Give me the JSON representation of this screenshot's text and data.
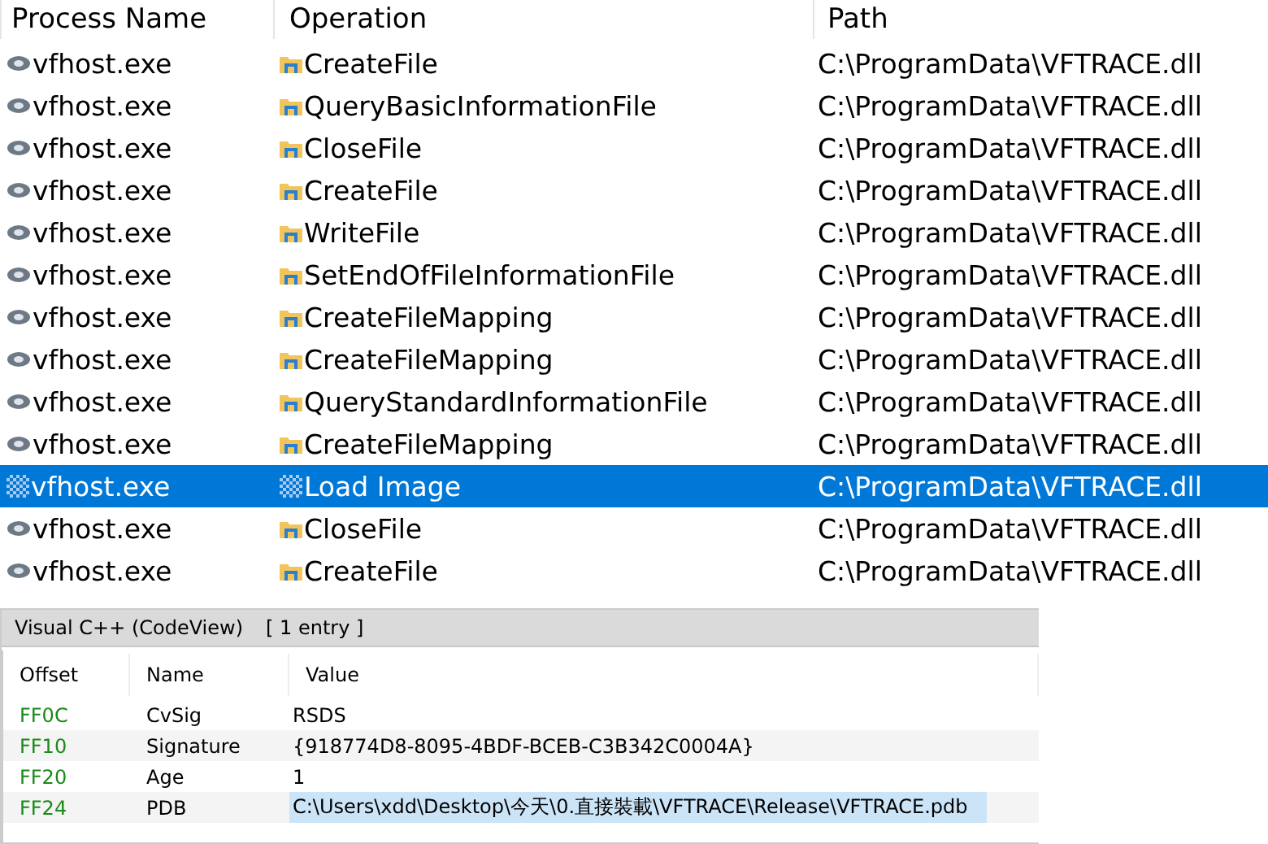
{
  "events": {
    "columns": [
      "Process Name",
      "Operation",
      "Path"
    ],
    "rows": [
      {
        "process": "vfhost.exe",
        "operation": "CreateFile",
        "kind": "file",
        "path": "C:\\ProgramData\\VFTRACE.dll",
        "selected": false
      },
      {
        "process": "vfhost.exe",
        "operation": "QueryBasicInformationFile",
        "kind": "file",
        "path": "C:\\ProgramData\\VFTRACE.dll",
        "selected": false
      },
      {
        "process": "vfhost.exe",
        "operation": "CloseFile",
        "kind": "file",
        "path": "C:\\ProgramData\\VFTRACE.dll",
        "selected": false
      },
      {
        "process": "vfhost.exe",
        "operation": "CreateFile",
        "kind": "file",
        "path": "C:\\ProgramData\\VFTRACE.dll",
        "selected": false
      },
      {
        "process": "vfhost.exe",
        "operation": "WriteFile",
        "kind": "file",
        "path": "C:\\ProgramData\\VFTRACE.dll",
        "selected": false
      },
      {
        "process": "vfhost.exe",
        "operation": "SetEndOfFileInformationFile",
        "kind": "file",
        "path": "C:\\ProgramData\\VFTRACE.dll",
        "selected": false
      },
      {
        "process": "vfhost.exe",
        "operation": "CreateFileMapping",
        "kind": "file",
        "path": "C:\\ProgramData\\VFTRACE.dll",
        "selected": false
      },
      {
        "process": "vfhost.exe",
        "operation": "CreateFileMapping",
        "kind": "file",
        "path": "C:\\ProgramData\\VFTRACE.dll",
        "selected": false
      },
      {
        "process": "vfhost.exe",
        "operation": "QueryStandardInformationFile",
        "kind": "file",
        "path": "C:\\ProgramData\\VFTRACE.dll",
        "selected": false
      },
      {
        "process": "vfhost.exe",
        "operation": "CreateFileMapping",
        "kind": "file",
        "path": "C:\\ProgramData\\VFTRACE.dll",
        "selected": false
      },
      {
        "process": "vfhost.exe",
        "operation": "Load Image",
        "kind": "image",
        "path": "C:\\ProgramData\\VFTRACE.dll",
        "selected": true
      },
      {
        "process": "vfhost.exe",
        "operation": "CloseFile",
        "kind": "file",
        "path": "C:\\ProgramData\\VFTRACE.dll",
        "selected": false
      },
      {
        "process": "vfhost.exe",
        "operation": "CreateFile",
        "kind": "file",
        "path": "C:\\ProgramData\\VFTRACE.dll",
        "selected": false
      }
    ]
  },
  "debug_panel": {
    "title": "Visual C++ (CodeView)",
    "count": "[ 1 entry ]",
    "columns": [
      "Offset",
      "Name",
      "Value"
    ],
    "rows": [
      {
        "offset": "FF0C",
        "name": "CvSig",
        "value": "RSDS",
        "selected": false
      },
      {
        "offset": "FF10",
        "name": "Signature",
        "value": "{918774D8-8095-4BDF-BCEB-C3B342C0004A}",
        "selected": false
      },
      {
        "offset": "FF20",
        "name": "Age",
        "value": "1",
        "selected": false
      },
      {
        "offset": "FF24",
        "name": "PDB",
        "value": "C:\\Users\\xdd\\Desktop\\今天\\0.直接裝載\\VFTRACE\\Release\\VFTRACE.pdb",
        "selected": true
      }
    ]
  }
}
